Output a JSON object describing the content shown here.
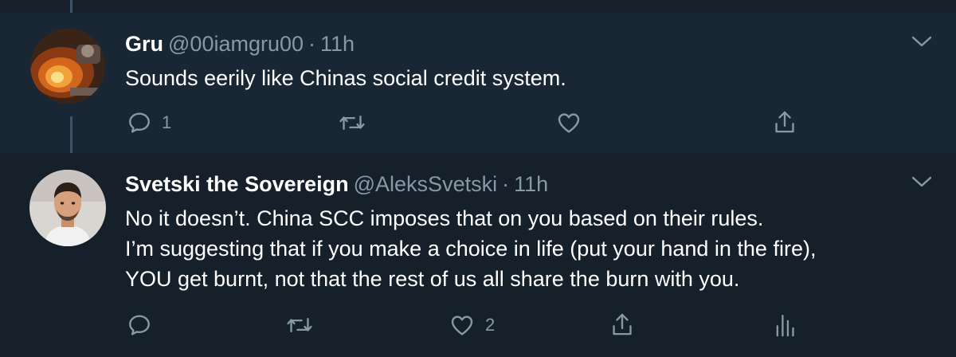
{
  "tweets": [
    {
      "name": "Gru",
      "handle": "@00iamgru00",
      "separator": "·",
      "time": "11h",
      "text_lines": [
        "Sounds eerily like Chinas social credit system."
      ],
      "reply_count": "1",
      "retweet_count": "",
      "like_count": "",
      "avatar_icon": "fire-cooking-avatar"
    },
    {
      "name": "Svetski the Sovereign",
      "handle": "@AleksSvetski",
      "separator": "·",
      "time": "11h",
      "text_lines": [
        "No it doesn’t. China SCC imposes that on you based on their rules.",
        "I’m suggesting that if you make a choice in life (put your hand in the fire),",
        "YOU get burnt, not that the rest of us all share the burn with you."
      ],
      "reply_count": "",
      "retweet_count": "",
      "like_count": "2",
      "avatar_icon": "portrait-avatar"
    }
  ],
  "colors": {
    "background": "#15202b",
    "highlight_background": "#192734",
    "secondary_text": "#8899a6",
    "thread_line": "#3d5466"
  }
}
